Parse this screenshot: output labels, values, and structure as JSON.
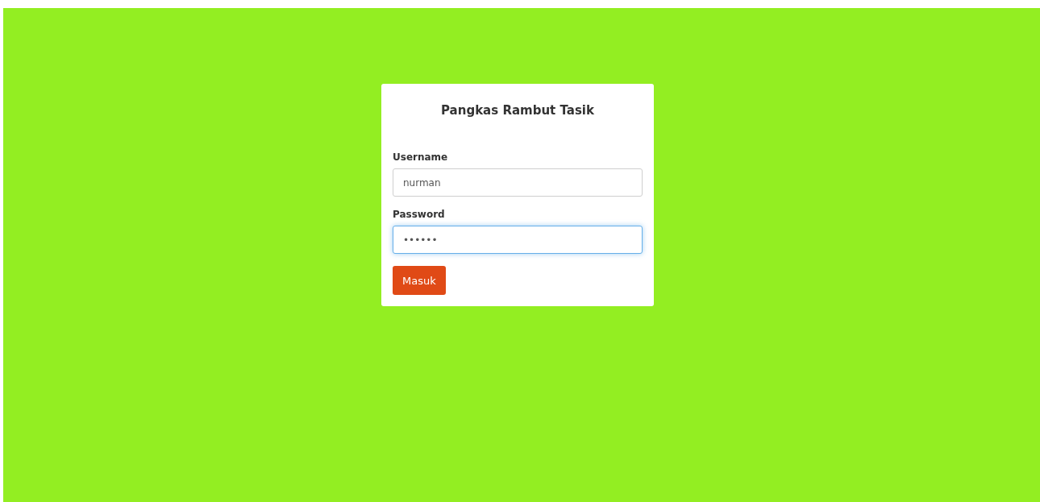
{
  "card": {
    "title": "Pangkas Rambut Tasik"
  },
  "fields": [
    {
      "label": "Username",
      "value": "nurman",
      "focused": false
    },
    {
      "label": "Password",
      "value": "••••••",
      "focused": true
    }
  ],
  "submit_button": {
    "label": "Masuk"
  }
}
